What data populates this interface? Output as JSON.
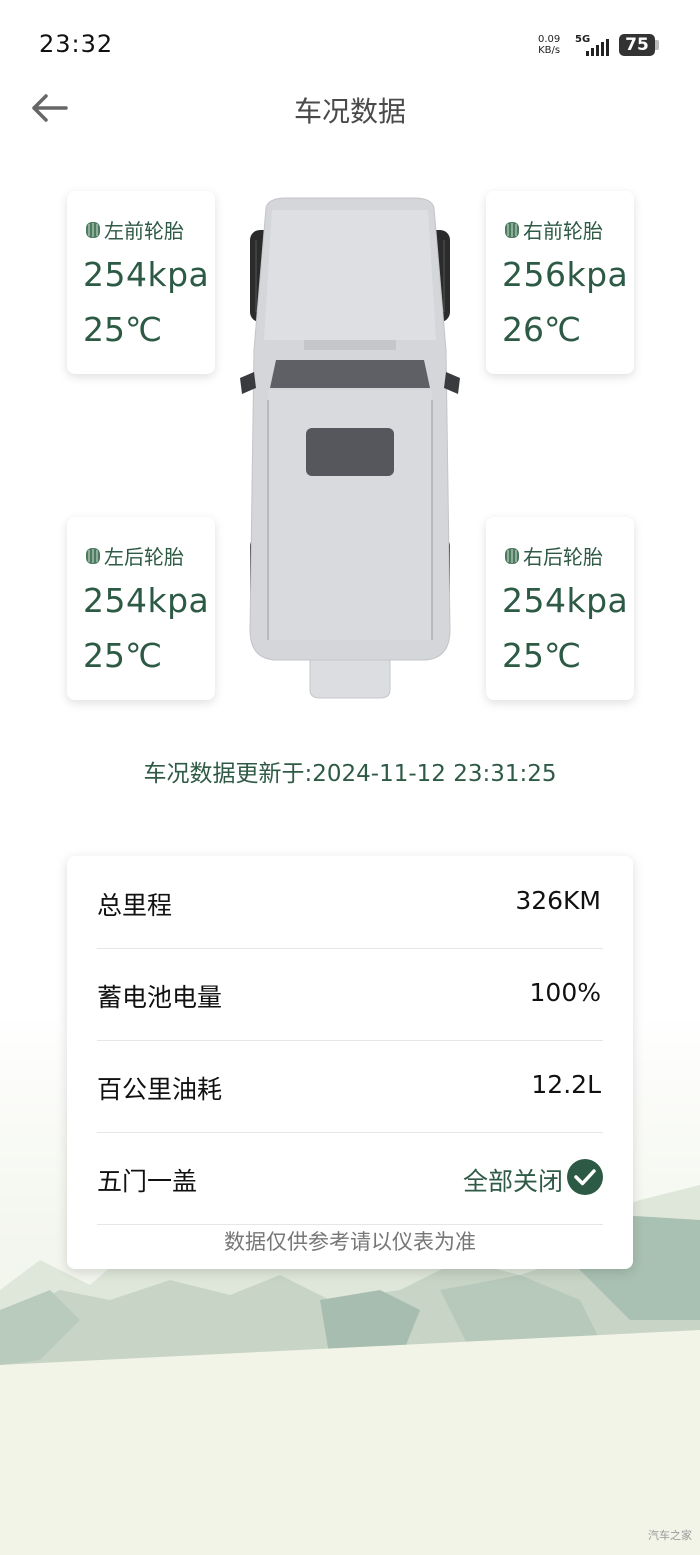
{
  "status_bar": {
    "time": "23:32",
    "net_speed_value": "0.09",
    "net_speed_unit": "KB/s",
    "network": "5G",
    "battery": "75"
  },
  "header": {
    "title": "车况数据"
  },
  "tires": {
    "front_left": {
      "label": "左前轮胎",
      "pressure": "254kpa",
      "temperature": "25℃"
    },
    "front_right": {
      "label": "右前轮胎",
      "pressure": "256kpa",
      "temperature": "26℃"
    },
    "rear_left": {
      "label": "左后轮胎",
      "pressure": "254kpa",
      "temperature": "25℃"
    },
    "rear_right": {
      "label": "右后轮胎",
      "pressure": "254kpa",
      "temperature": "25℃"
    }
  },
  "update_time": "车况数据更新于:2024-11-12 23:31:25",
  "info": {
    "total_mileage": {
      "label": "总里程",
      "value": "326KM"
    },
    "battery_level": {
      "label": "蓄电池电量",
      "value": "100%"
    },
    "fuel_consumption": {
      "label": "百公里油耗",
      "value": "12.2L"
    },
    "doors": {
      "label": "五门一盖",
      "value": "全部关闭"
    },
    "note": "数据仅供参考请以仪表为准"
  },
  "watermark": "汽车之家",
  "colors": {
    "accent_green": "#2d5a45",
    "text_dark": "#111111",
    "muted_text": "#777777"
  },
  "icons": [
    "back-arrow-icon",
    "tire-icon",
    "check-circle-icon",
    "signal-bars-icon",
    "battery-icon"
  ]
}
